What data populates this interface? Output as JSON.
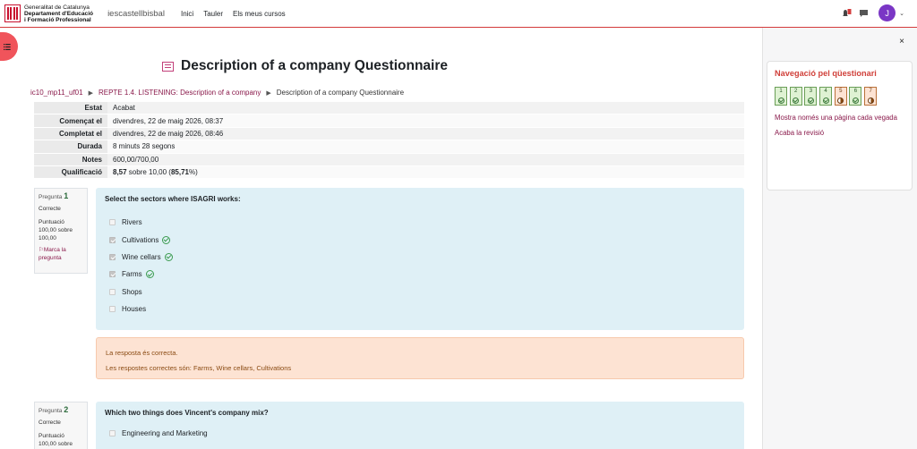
{
  "header": {
    "org_line1": "Generalitat de Catalunya",
    "org_line2": "Departament d'Educació",
    "org_line3": "i Formació Professional",
    "site_name": "iescastellbisbal",
    "nav": [
      "Inici",
      "Tauler",
      "Els meus cursos"
    ],
    "avatar_initial": "J",
    "icons": [
      "bell-icon",
      "chat-icon",
      "chevron-down-icon",
      "menu-icon"
    ]
  },
  "page": {
    "title": "Description of a company Questionnaire",
    "breadcrumb": [
      "ic10_mp11_uf01",
      "REPTE 1.4. LISTENING: Description of a company",
      "Description of a company Questionnaire"
    ]
  },
  "summary": [
    {
      "label": "Estat",
      "value": "Acabat"
    },
    {
      "label": "Començat el",
      "value": "divendres, 22 de maig 2026, 08:37"
    },
    {
      "label": "Completat el",
      "value": "divendres, 22 de maig 2026, 08:46"
    },
    {
      "label": "Durada",
      "value": "8 minuts 28 segons"
    },
    {
      "label": "Notes",
      "value": "600,00/700,00"
    },
    {
      "label": "Qualificació",
      "value_bold": "8,57",
      "value_mid": " sobre 10,00 (",
      "value_pct": "85,71",
      "value_end": "%)"
    }
  ],
  "questions": [
    {
      "label": "Pregunta",
      "number": "1",
      "state": "Correcte",
      "mark_line1": "Puntuació",
      "mark_line2": "100,00 sobre",
      "mark_line3": "100,00",
      "flag_line1": "Marca la",
      "flag_line2": "pregunta",
      "text": "Select the sectors where ISAGRI works:",
      "options": [
        {
          "label": "Rivers",
          "checked": false,
          "correct": false
        },
        {
          "label": "Cultivations",
          "checked": true,
          "correct": true
        },
        {
          "label": "Wine cellars",
          "checked": true,
          "correct": true
        },
        {
          "label": "Farms",
          "checked": true,
          "correct": true
        },
        {
          "label": "Shops",
          "checked": false,
          "correct": false
        },
        {
          "label": "Houses",
          "checked": false,
          "correct": false
        }
      ],
      "feedback_line1": "La resposta és correcta.",
      "feedback_line2": "Les respostes correctes són: Farms, Wine cellars, Cultivations"
    },
    {
      "label": "Pregunta",
      "number": "2",
      "state": "Correcte",
      "mark_line1": "Puntuació",
      "mark_line2": "100,00 sobre",
      "text": "Which two things does Vincent's company mix?",
      "options": [
        {
          "label": "Engineering and Marketing",
          "checked": false,
          "correct": false
        }
      ]
    }
  ],
  "quiz_nav": {
    "title": "Navegació pel qüestionari",
    "buttons": [
      {
        "n": "1",
        "state": "correct"
      },
      {
        "n": "2",
        "state": "correct"
      },
      {
        "n": "3",
        "state": "correct"
      },
      {
        "n": "4",
        "state": "correct"
      },
      {
        "n": "5",
        "state": "partial"
      },
      {
        "n": "6",
        "state": "correct"
      },
      {
        "n": "7",
        "state": "partial"
      }
    ],
    "link_one_page": "Mostra només una pàgina cada vegada",
    "link_finish": "Acaba la revisió",
    "close": "×"
  },
  "colors": {
    "accent": "#d33b3b",
    "link": "#8a1a4b",
    "question_bg": "#dff0f6",
    "feedback_bg": "#fde3d3",
    "avatar": "#7a36c5"
  }
}
